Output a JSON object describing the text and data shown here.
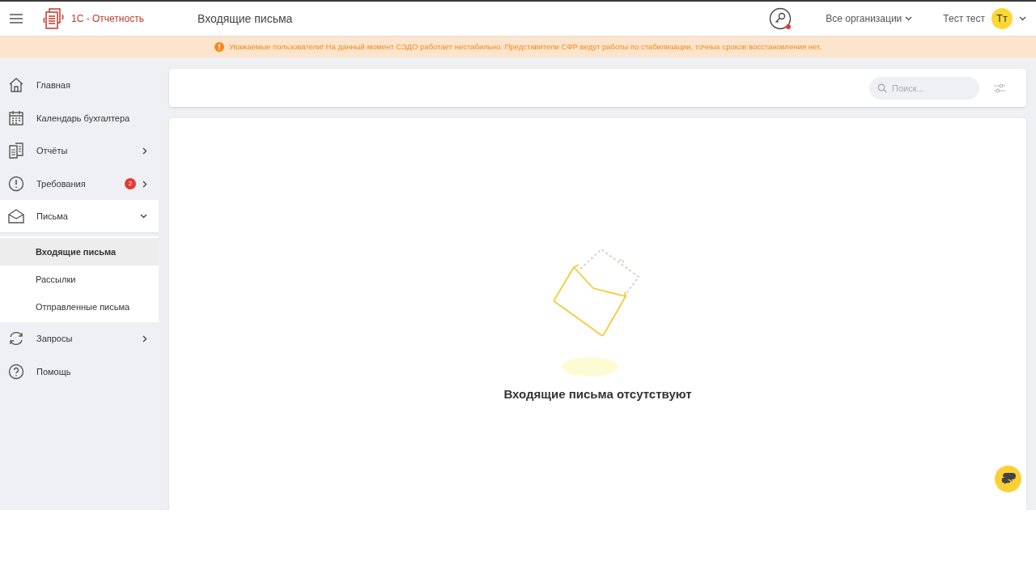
{
  "header": {
    "app_name": "1С - Отчетность",
    "page_title": "Входящие письма",
    "org_selector": "Все организации",
    "user_name": "Тест тест",
    "avatar_initials": "Тт"
  },
  "banner": {
    "text": "Уважаемые пользователи! На данный момент СЭДО работает нестабильно. Представители СФР ведут работы по стабилизации, точных сроков восстановления нет."
  },
  "sidebar": {
    "items": [
      {
        "label": "Главная"
      },
      {
        "label": "Календарь бухгалтера"
      },
      {
        "label": "Отчёты",
        "expanded": false
      },
      {
        "label": "Требования",
        "badge": "2",
        "expanded": false
      },
      {
        "label": "Письма",
        "expanded": true,
        "children": [
          {
            "label": "Входящие письма",
            "selected": true
          },
          {
            "label": "Рассылки",
            "selected": false
          },
          {
            "label": "Отправленные письма",
            "selected": false
          }
        ]
      },
      {
        "label": "Запросы",
        "expanded": false
      },
      {
        "label": "Помощь"
      }
    ]
  },
  "search": {
    "placeholder": "Поиск..."
  },
  "empty_state": {
    "message": "Входящие письма отсутствуют"
  }
}
